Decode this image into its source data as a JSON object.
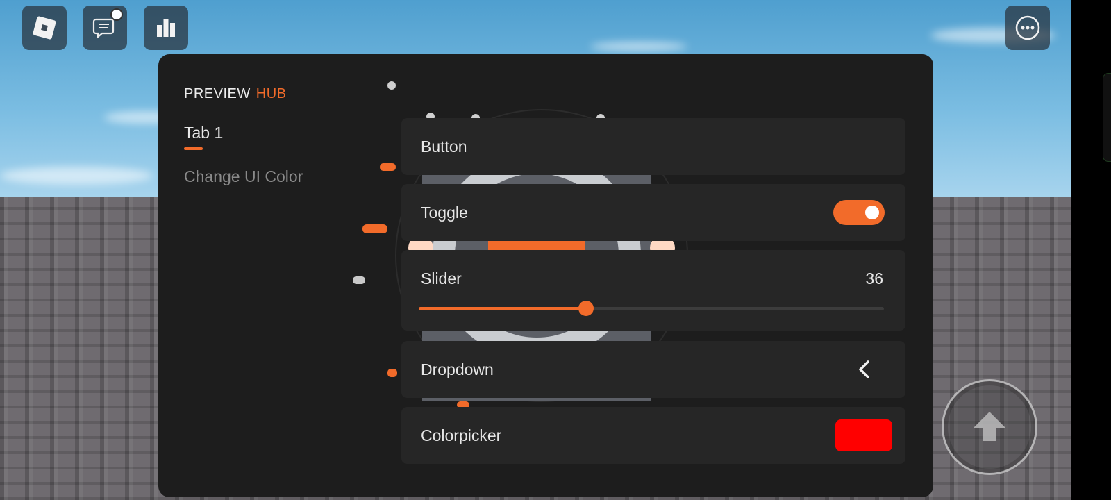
{
  "topbar": {
    "roblox_icon": "roblox-logo-icon",
    "chat_icon": "chat-icon",
    "leaderboard_icon": "leaderboard-icon",
    "more_icon": "more-options-icon"
  },
  "hub": {
    "title_part1": "PREVIEW",
    "title_part2": "HUB",
    "accent_color": "#f26b2a",
    "tabs": [
      {
        "label": "Tab 1",
        "active": true
      },
      {
        "label": "Change UI Color",
        "active": false
      }
    ]
  },
  "elements": {
    "button": {
      "label": "Button"
    },
    "toggle": {
      "label": "Toggle",
      "state": true
    },
    "slider": {
      "label": "Slider",
      "value": "36",
      "fraction": 0.36
    },
    "dropdown": {
      "label": "Dropdown",
      "icon": "chevron-left-icon"
    },
    "colorpicker": {
      "label": "Colorpicker",
      "color": "#ff0000"
    }
  },
  "controls": {
    "jump_icon": "jump-arrow-icon"
  }
}
